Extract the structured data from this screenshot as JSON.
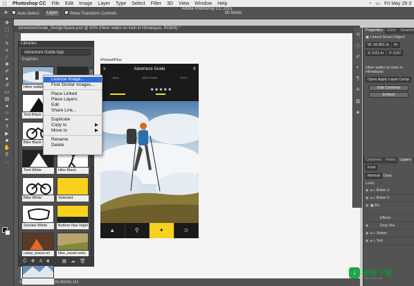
{
  "menubar": {
    "apple": "",
    "app": "Photoshop CC",
    "items": [
      "File",
      "Edit",
      "Image",
      "Layer",
      "Type",
      "Select",
      "Filter",
      "3D",
      "View",
      "Window",
      "Help"
    ],
    "clock": "Fri May 29 3"
  },
  "window": {
    "title": "Adobe Photoshop CC 2015"
  },
  "options": {
    "auto_select": "Auto-Select:",
    "layer_value": "Layer",
    "transform": "Show Transform Controls",
    "mode": "3D Mode:"
  },
  "document": {
    "tab": "AdventureGuide_DesignSpace.psd @ 50% (Hiker walks on train in Himalayas, RGB/8) *",
    "zoom": "50%",
    "doc_size": "Doc: 26.8M/46.1M"
  },
  "libraries": {
    "header": "Libraries",
    "library": "Adventure Guide App",
    "section": "Graphics",
    "items": [
      {
        "label": "Hiker walking"
      },
      {
        "label": ""
      },
      {
        "label": "Tent Black"
      },
      {
        "label": ""
      },
      {
        "label": "Bike Black"
      },
      {
        "label": ""
      },
      {
        "label": "Tent White"
      },
      {
        "label": "Hike Black"
      },
      {
        "label": "Bike White"
      },
      {
        "label": "Selected"
      },
      {
        "label": "Snorkel White"
      },
      {
        "label": "Bottom Nav Highl"
      },
      {
        "label": "camp_travel-rei"
      },
      {
        "label": "hike_travel-retro"
      },
      {
        "label": ""
      }
    ]
  },
  "context_menu": {
    "items": [
      "License Image...",
      "Find Similar Images...",
      "Place Linked",
      "Place Layers",
      "Edit",
      "Share Link...",
      "Duplicate",
      "Copy to",
      "Move to",
      "Rename",
      "Delete"
    ]
  },
  "artboard": {
    "label": "iPhone6Plus",
    "app_title": "Adventure Guide",
    "tabs": [
      "HIKE",
      "WEATHER",
      "TIPS"
    ],
    "rating": "★★★★★"
  },
  "properties": {
    "tabs": [
      "Properties",
      "Color",
      "Swatches"
    ],
    "kind": "Linked Smart Object",
    "w": "W: 36.861 in",
    "h": "H:",
    "x": "X: 0.51 in",
    "y": "Y: 0.67",
    "name": "Hiker walks on train in Himalayas.",
    "license": "Open Apply Layer Comp",
    "edit_btn": "Edit Contents",
    "embed_btn": "Embed"
  },
  "layers_panel": {
    "tabs": [
      "Channels",
      "Paths",
      "Layers"
    ],
    "filter": "Kind",
    "blend": "Normal",
    "opacity_label": "Opac",
    "lock_label": "Lock:",
    "rows": [
      "Button 3",
      "Button 2",
      "BG",
      "Effects",
      "Drop Sha",
      "Swiper",
      "Text"
    ]
  },
  "watermark": {
    "name": "神奇下载",
    "url": "www.sqxz.com"
  }
}
